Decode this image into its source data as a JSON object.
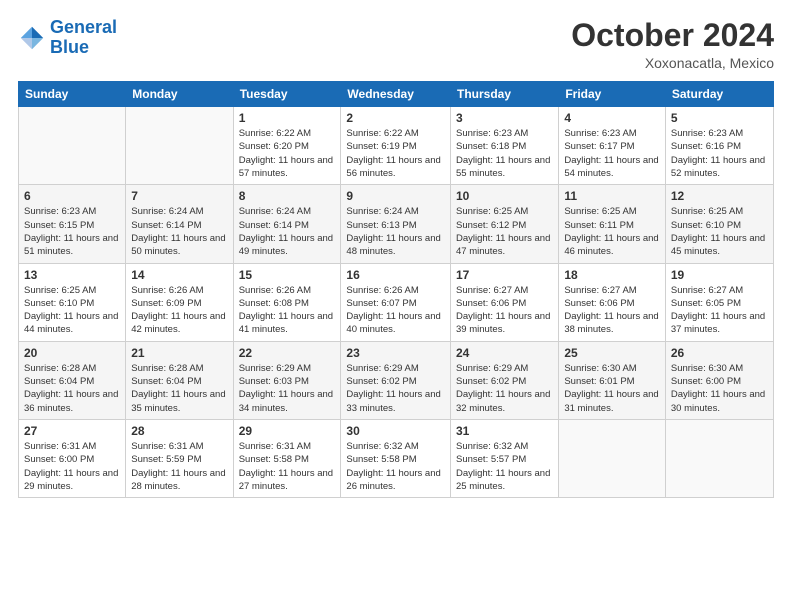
{
  "logo": {
    "line1": "General",
    "line2": "Blue"
  },
  "header": {
    "month": "October 2024",
    "location": "Xoxonacatla, Mexico"
  },
  "days_of_week": [
    "Sunday",
    "Monday",
    "Tuesday",
    "Wednesday",
    "Thursday",
    "Friday",
    "Saturday"
  ],
  "weeks": [
    [
      {
        "day": "",
        "info": ""
      },
      {
        "day": "",
        "info": ""
      },
      {
        "day": "1",
        "info": "Sunrise: 6:22 AM\nSunset: 6:20 PM\nDaylight: 11 hours and 57 minutes."
      },
      {
        "day": "2",
        "info": "Sunrise: 6:22 AM\nSunset: 6:19 PM\nDaylight: 11 hours and 56 minutes."
      },
      {
        "day": "3",
        "info": "Sunrise: 6:23 AM\nSunset: 6:18 PM\nDaylight: 11 hours and 55 minutes."
      },
      {
        "day": "4",
        "info": "Sunrise: 6:23 AM\nSunset: 6:17 PM\nDaylight: 11 hours and 54 minutes."
      },
      {
        "day": "5",
        "info": "Sunrise: 6:23 AM\nSunset: 6:16 PM\nDaylight: 11 hours and 52 minutes."
      }
    ],
    [
      {
        "day": "6",
        "info": "Sunrise: 6:23 AM\nSunset: 6:15 PM\nDaylight: 11 hours and 51 minutes."
      },
      {
        "day": "7",
        "info": "Sunrise: 6:24 AM\nSunset: 6:14 PM\nDaylight: 11 hours and 50 minutes."
      },
      {
        "day": "8",
        "info": "Sunrise: 6:24 AM\nSunset: 6:14 PM\nDaylight: 11 hours and 49 minutes."
      },
      {
        "day": "9",
        "info": "Sunrise: 6:24 AM\nSunset: 6:13 PM\nDaylight: 11 hours and 48 minutes."
      },
      {
        "day": "10",
        "info": "Sunrise: 6:25 AM\nSunset: 6:12 PM\nDaylight: 11 hours and 47 minutes."
      },
      {
        "day": "11",
        "info": "Sunrise: 6:25 AM\nSunset: 6:11 PM\nDaylight: 11 hours and 46 minutes."
      },
      {
        "day": "12",
        "info": "Sunrise: 6:25 AM\nSunset: 6:10 PM\nDaylight: 11 hours and 45 minutes."
      }
    ],
    [
      {
        "day": "13",
        "info": "Sunrise: 6:25 AM\nSunset: 6:10 PM\nDaylight: 11 hours and 44 minutes."
      },
      {
        "day": "14",
        "info": "Sunrise: 6:26 AM\nSunset: 6:09 PM\nDaylight: 11 hours and 42 minutes."
      },
      {
        "day": "15",
        "info": "Sunrise: 6:26 AM\nSunset: 6:08 PM\nDaylight: 11 hours and 41 minutes."
      },
      {
        "day": "16",
        "info": "Sunrise: 6:26 AM\nSunset: 6:07 PM\nDaylight: 11 hours and 40 minutes."
      },
      {
        "day": "17",
        "info": "Sunrise: 6:27 AM\nSunset: 6:06 PM\nDaylight: 11 hours and 39 minutes."
      },
      {
        "day": "18",
        "info": "Sunrise: 6:27 AM\nSunset: 6:06 PM\nDaylight: 11 hours and 38 minutes."
      },
      {
        "day": "19",
        "info": "Sunrise: 6:27 AM\nSunset: 6:05 PM\nDaylight: 11 hours and 37 minutes."
      }
    ],
    [
      {
        "day": "20",
        "info": "Sunrise: 6:28 AM\nSunset: 6:04 PM\nDaylight: 11 hours and 36 minutes."
      },
      {
        "day": "21",
        "info": "Sunrise: 6:28 AM\nSunset: 6:04 PM\nDaylight: 11 hours and 35 minutes."
      },
      {
        "day": "22",
        "info": "Sunrise: 6:29 AM\nSunset: 6:03 PM\nDaylight: 11 hours and 34 minutes."
      },
      {
        "day": "23",
        "info": "Sunrise: 6:29 AM\nSunset: 6:02 PM\nDaylight: 11 hours and 33 minutes."
      },
      {
        "day": "24",
        "info": "Sunrise: 6:29 AM\nSunset: 6:02 PM\nDaylight: 11 hours and 32 minutes."
      },
      {
        "day": "25",
        "info": "Sunrise: 6:30 AM\nSunset: 6:01 PM\nDaylight: 11 hours and 31 minutes."
      },
      {
        "day": "26",
        "info": "Sunrise: 6:30 AM\nSunset: 6:00 PM\nDaylight: 11 hours and 30 minutes."
      }
    ],
    [
      {
        "day": "27",
        "info": "Sunrise: 6:31 AM\nSunset: 6:00 PM\nDaylight: 11 hours and 29 minutes."
      },
      {
        "day": "28",
        "info": "Sunrise: 6:31 AM\nSunset: 5:59 PM\nDaylight: 11 hours and 28 minutes."
      },
      {
        "day": "29",
        "info": "Sunrise: 6:31 AM\nSunset: 5:58 PM\nDaylight: 11 hours and 27 minutes."
      },
      {
        "day": "30",
        "info": "Sunrise: 6:32 AM\nSunset: 5:58 PM\nDaylight: 11 hours and 26 minutes."
      },
      {
        "day": "31",
        "info": "Sunrise: 6:32 AM\nSunset: 5:57 PM\nDaylight: 11 hours and 25 minutes."
      },
      {
        "day": "",
        "info": ""
      },
      {
        "day": "",
        "info": ""
      }
    ]
  ]
}
